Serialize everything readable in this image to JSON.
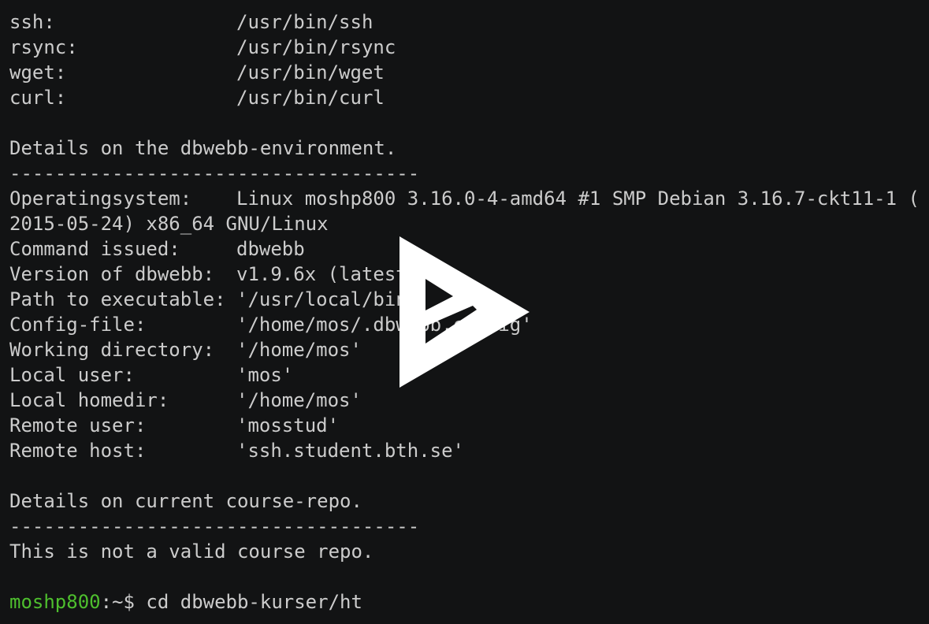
{
  "terminal": {
    "tools": [
      {
        "label": "ssh:",
        "value": "/usr/bin/ssh"
      },
      {
        "label": "rsync:",
        "value": "/usr/bin/rsync"
      },
      {
        "label": "wget:",
        "value": "/usr/bin/wget"
      },
      {
        "label": "curl:",
        "value": "/usr/bin/curl"
      }
    ],
    "env_heading": "Details on the dbwebb-environment.",
    "separator": "------------------------------------",
    "env": {
      "os_label": "Operatingsystem:",
      "os_value": "Linux moshp800 3.16.0-4-amd64 #1 SMP Debian 3.16.7-ckt11-1 (",
      "os_value_cont": "2015-05-24) x86_64 GNU/Linux",
      "items": [
        {
          "label": "Command issued:",
          "value": "dbwebb"
        },
        {
          "label": "Version of dbwebb:",
          "value": "v1.9.6x (latest"
        },
        {
          "label": "Path to executable:",
          "value": "'/usr/local/bin"
        },
        {
          "label": "Config-file:",
          "value": "'/home/mos/.dbwebb.config'"
        },
        {
          "label": "Working directory:",
          "value": "'/home/mos'"
        },
        {
          "label": "Local user:",
          "value": "'mos'"
        },
        {
          "label": "Local homedir:",
          "value": "'/home/mos'"
        },
        {
          "label": "Remote user:",
          "value": "'mosstud'"
        },
        {
          "label": "Remote host:",
          "value": "'ssh.student.bth.se'"
        }
      ]
    },
    "repo_heading": "Details on current course-repo.",
    "repo_message": "This is not a valid course repo.",
    "prompt": {
      "host": "moshp800",
      "path_symbol": ":~$ ",
      "command": "cd dbwebb-kurser/ht"
    }
  },
  "overlay": {
    "icon": "asciinema-play-icon",
    "color": "#ffffff"
  },
  "colors": {
    "background": "#121314",
    "text": "#cccccc",
    "prompt_host": "#4ebf2e"
  }
}
